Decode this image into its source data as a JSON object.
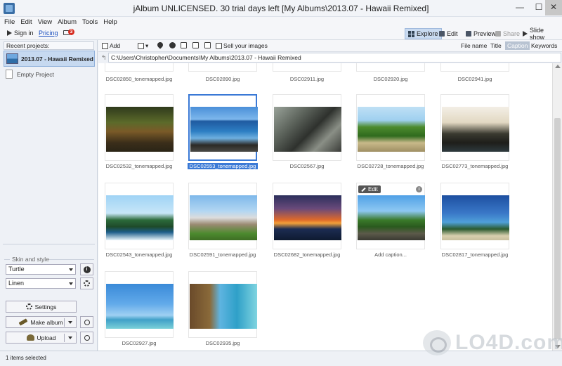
{
  "window": {
    "title": "jAlbum UNLICENSED. 30 trial days left [My Albums\\2013.07 - Hawaii Remixed]",
    "min_label": "—",
    "max_label": "☐",
    "close_label": "✕"
  },
  "menu": [
    "File",
    "Edit",
    "View",
    "Album",
    "Tools",
    "Help"
  ],
  "account": {
    "signin_label": "Sign in",
    "pricing_label": "Pricing",
    "notification_count": "3"
  },
  "modes": {
    "explore": "Explore",
    "edit": "Edit",
    "preview": "Preview",
    "share": "Share",
    "slideshow": "Slide show"
  },
  "sidebar": {
    "recent_label": "Recent projects:",
    "projects": [
      {
        "label": "2013.07 - Hawaii Remixed",
        "active": true
      },
      {
        "label": "Empty Project",
        "active": false
      }
    ],
    "skin_section_label": "Skin and style",
    "skin_value": "Turtle",
    "style_value": "Linen",
    "settings_label": "Settings",
    "make_album_label": "Make album",
    "upload_label": "Upload"
  },
  "content_toolbar": {
    "add_label": "Add",
    "sell_label": "Sell your images",
    "sort_options": [
      "File name",
      "Title",
      "Caption",
      "Keywords"
    ],
    "active_sort": "Caption"
  },
  "path": {
    "value": "C:\\Users\\Christopher\\Documents\\My Albums\\2013.07 - Hawaii Remixed"
  },
  "gallery": {
    "top_row_captions": [
      "DSC02850_tonemapped.jpg",
      "DSC02890.jpg",
      "DSC02911.jpg",
      "DSC02920.jpg",
      "DSC02941.jpg"
    ],
    "items": [
      {
        "caption": "DSC02532_tonemapped.jpg",
        "scene": "truck"
      },
      {
        "caption": "DSC02553_tonemapped.jpg",
        "scene": "ocean",
        "selected": true
      },
      {
        "caption": "DSC02567.jpg",
        "scene": "rocks"
      },
      {
        "caption": "DSC02728_tonemapped.jpg",
        "scene": "palms"
      },
      {
        "caption": "DSC02773_tonemapped.jpg",
        "scene": "bird"
      },
      {
        "caption": "DSC02543_tonemapped.jpg",
        "scene": "coast"
      },
      {
        "caption": "DSC02591_tonemapped.jpg",
        "scene": "church"
      },
      {
        "caption": "DSC02682_tonemapped.jpg",
        "scene": "sunset"
      },
      {
        "caption": "Add caption...",
        "scene": "palmbeach",
        "hover": true
      },
      {
        "caption": "DSC02817_tonemapped.jpg",
        "scene": "beach2"
      },
      {
        "caption": "DSC02927.jpg",
        "scene": "tree"
      },
      {
        "caption": "DSC02935.jpg",
        "scene": "trunk"
      }
    ],
    "edit_badge_label": "Edit"
  },
  "status": {
    "text": "1 items selected"
  },
  "watermark": {
    "text": "LO4D.com"
  },
  "colors": {
    "accent": "#3a79d6",
    "active_mode_bg": "#c9daf0",
    "notification_badge": "#d62b1f"
  }
}
